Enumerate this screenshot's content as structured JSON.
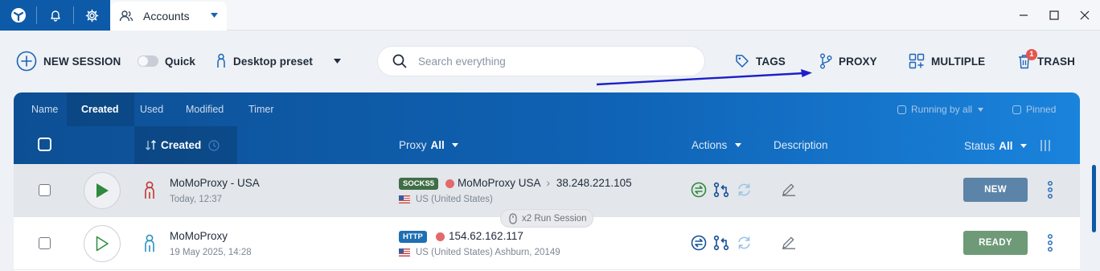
{
  "window": {
    "tab_label": "Accounts"
  },
  "toolbar": {
    "new_session": "NEW SESSION",
    "quick": "Quick",
    "preset": "Desktop preset",
    "search_placeholder": "Search everything",
    "tags": "TAGS",
    "proxy": "PROXY",
    "multiple": "MULTIPLE",
    "trash": "TRASH",
    "trash_badge": "1"
  },
  "sort_tabs": [
    "Name",
    "Created",
    "Used",
    "Modified",
    "Timer"
  ],
  "filters": {
    "running": "Running by all",
    "pinned": "Pinned"
  },
  "columns": {
    "created": "Created",
    "proxy": "Proxy",
    "proxy_filter": "All",
    "actions": "Actions",
    "description": "Description",
    "status": "Status",
    "status_filter": "All"
  },
  "rows": [
    {
      "name": "MoMoProxy - USA",
      "date": "Today, 12:37",
      "protocol": "SOCKS5",
      "proxy_name": "MoMoProxy USA",
      "proxy_ip": "38.248.221.105",
      "location": "US (United States)",
      "status": "NEW"
    },
    {
      "name": "MoMoProxy",
      "date": "19 May 2025, 14:28",
      "protocol": "HTTP",
      "proxy_ip": "154.62.162.117",
      "location": "US (United States) Ashburn, 20149",
      "status": "READY"
    }
  ],
  "tooltip": "x2 Run Session",
  "colors": {
    "brand": "#0d5aa8",
    "socks5": "#3f6e46",
    "http": "#1f6fb3",
    "status_new": "#5b84a8",
    "status_ready": "#6e9a78",
    "annotation_arrow": "#1c1fc8"
  }
}
